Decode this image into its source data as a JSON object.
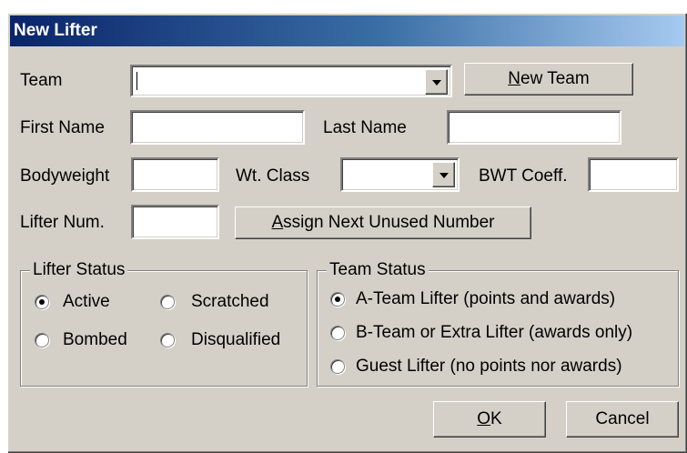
{
  "dialog": {
    "title": "New Lifter"
  },
  "form": {
    "team_label": "Team",
    "team_value": "",
    "new_team_prefix": "",
    "new_team_mnemonic": "N",
    "new_team_rest": "ew Team",
    "first_name_label": "First Name",
    "first_name_value": "",
    "last_name_label": "Last Name",
    "last_name_value": "",
    "bodyweight_label": "Bodyweight",
    "bodyweight_value": "",
    "wt_class_label": "Wt. Class",
    "wt_class_value": "",
    "bwt_coeff_label": "BWT Coeff.",
    "bwt_coeff_value": "",
    "lifter_num_label": "Lifter Num.",
    "lifter_num_value": "",
    "assign_mnemonic": "A",
    "assign_rest": "ssign Next Unused Number"
  },
  "lifter_status": {
    "legend": "Lifter Status",
    "options": [
      {
        "label": "Active",
        "checked": true
      },
      {
        "label": "Scratched",
        "checked": false
      },
      {
        "label": "Bombed",
        "checked": false
      },
      {
        "label": "Disqualified",
        "checked": false
      }
    ]
  },
  "team_status": {
    "legend": "Team Status",
    "options": [
      {
        "label": "A-Team Lifter (points and awards)",
        "checked": true
      },
      {
        "label": "B-Team or Extra Lifter (awards only)",
        "checked": false
      },
      {
        "label": "Guest Lifter (no points nor awards)",
        "checked": false
      }
    ]
  },
  "buttons": {
    "ok_mnemonic": "O",
    "ok_rest": "K",
    "cancel": "Cancel"
  }
}
